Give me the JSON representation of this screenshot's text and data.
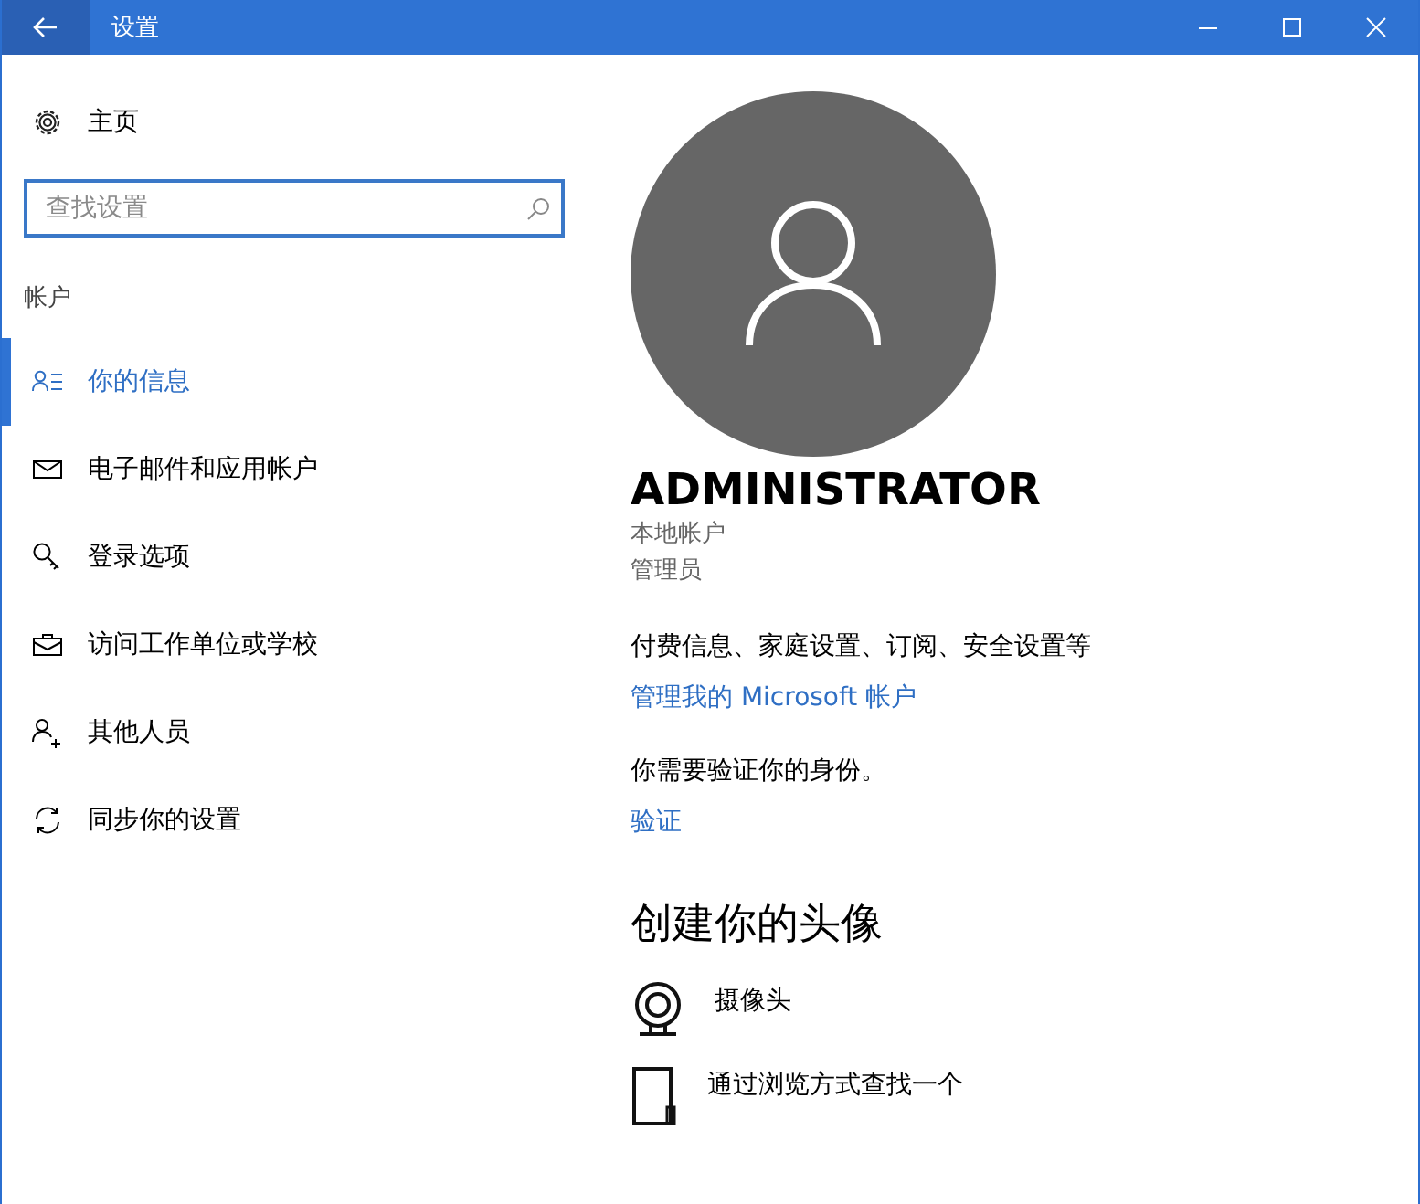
{
  "window": {
    "title": "设置"
  },
  "sidebar": {
    "home": "主页",
    "search": {
      "placeholder": "查找设置"
    },
    "section": "帐户",
    "items": [
      {
        "kind": "user-info",
        "label": "你的信息",
        "selected": true
      },
      {
        "kind": "mail",
        "label": "电子邮件和应用帐户",
        "selected": false
      },
      {
        "kind": "key",
        "label": "登录选项",
        "selected": false
      },
      {
        "kind": "briefcase",
        "label": "访问工作单位或学校",
        "selected": false
      },
      {
        "kind": "add-person",
        "label": "其他人员",
        "selected": false
      },
      {
        "kind": "sync",
        "label": "同步你的设置",
        "selected": false
      }
    ]
  },
  "account": {
    "name": "ADMINISTRATOR",
    "type": "本地帐户",
    "role": "管理员",
    "billing_text": "付费信息、家庭设置、订阅、安全设置等",
    "manage_link": "管理我的 Microsoft 帐户",
    "verify_text": "你需要验证你的身份。",
    "verify_link": "验证"
  },
  "avatar_section": {
    "title": "创建你的头像",
    "options": [
      {
        "kind": "camera",
        "label": "摄像头"
      },
      {
        "kind": "browse",
        "label": "通过浏览方式查找一个"
      }
    ]
  }
}
